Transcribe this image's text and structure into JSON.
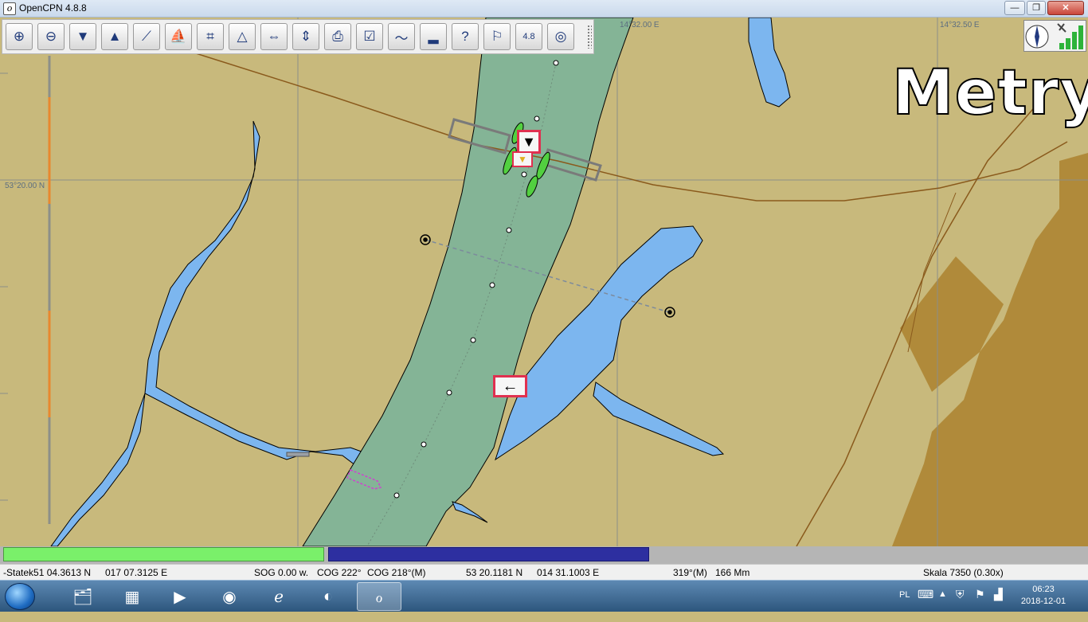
{
  "window": {
    "title": "OpenCPN 4.8.8",
    "minimize": "—",
    "maximize": "❐",
    "close": "✕"
  },
  "toolbar": {
    "tools": [
      {
        "name": "zoom-in-icon",
        "glyph": "⊕"
      },
      {
        "name": "zoom-out-icon",
        "glyph": "⊖"
      },
      {
        "name": "scale-down-icon",
        "glyph": "▼"
      },
      {
        "name": "scale-up-icon",
        "glyph": "▲"
      },
      {
        "name": "route-icon",
        "glyph": "⟋"
      },
      {
        "name": "ship-icon",
        "glyph": "⛵"
      },
      {
        "name": "measure-icon",
        "glyph": "⌗"
      },
      {
        "name": "ais-icon",
        "glyph": "△"
      },
      {
        "name": "auto-follow-icon",
        "glyph": "⇔"
      },
      {
        "name": "settings-icon",
        "glyph": "⇕"
      },
      {
        "name": "print-icon",
        "glyph": "⎙"
      },
      {
        "name": "route-manager-icon",
        "glyph": "☑"
      },
      {
        "name": "track-icon",
        "glyph": "〜"
      },
      {
        "name": "tide-icon",
        "glyph": "▂"
      },
      {
        "name": "help-icon",
        "glyph": "?"
      },
      {
        "name": "mob-icon",
        "glyph": "⚐"
      },
      {
        "name": "version-icon",
        "glyph": "4.8"
      },
      {
        "name": "lifebuoy-icon",
        "glyph": "◎"
      }
    ]
  },
  "chart": {
    "units_label": "Metry",
    "top_lon_labels": [
      "14°32.00 E",
      "14°32.50 E"
    ],
    "left_lat_label": "53°20.00 N"
  },
  "status": {
    "ship": "-Statek51 04.3613 N",
    "ship_lon": "017 07.3125 E",
    "sog": "SOG 0.00 w.",
    "cog_true": "COG 222°",
    "cog_mag": "COG 218°(M)",
    "cursor_lat": "53 20.1181 N",
    "cursor_lon": "014 31.1003 E",
    "bearing": "319°(M)",
    "distance": "166 Mm",
    "scale": "Skala 7350 (0.30x)"
  },
  "sign": {
    "arrow": "←"
  },
  "taskbar": {
    "apps": [
      {
        "name": "explorer-icon",
        "glyph": "🗂"
      },
      {
        "name": "calculator-icon",
        "glyph": "▦"
      },
      {
        "name": "media-player-icon",
        "glyph": "▶"
      },
      {
        "name": "chrome-icon",
        "glyph": "◉"
      },
      {
        "name": "ie-icon",
        "glyph": "ℯ"
      },
      {
        "name": "firefox-icon",
        "glyph": "◐"
      },
      {
        "name": "opencpn-icon",
        "glyph": "ℴ"
      }
    ],
    "language": "PL",
    "time": "06:23",
    "date": "2018-12-01"
  },
  "colors": {
    "land": "#c8b97c",
    "water": "#7cb6ef",
    "channel": "#84b496",
    "dark_land": "#b08a3a"
  }
}
